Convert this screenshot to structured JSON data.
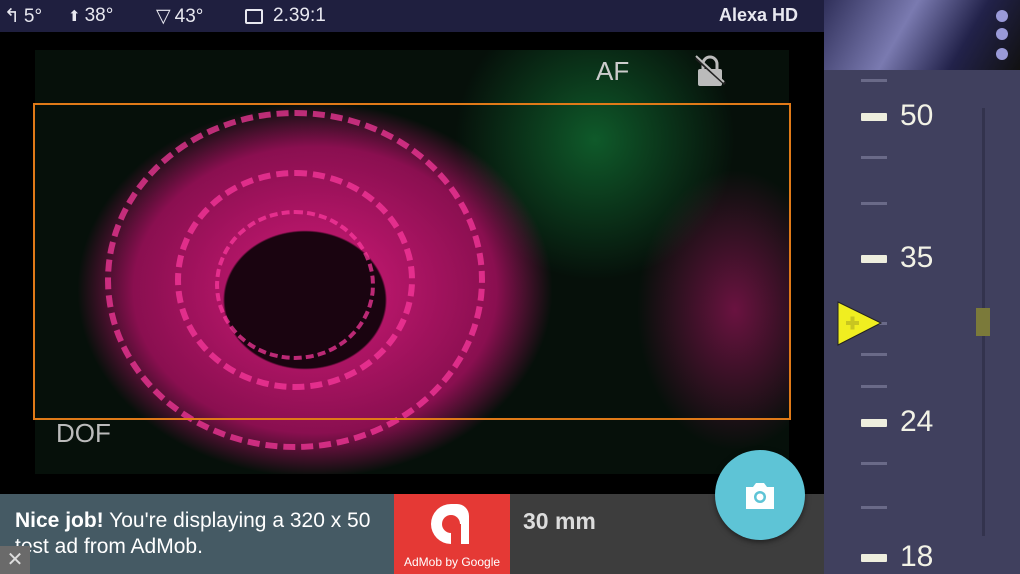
{
  "status_bar": {
    "tilt": "5°",
    "pitch": "38°",
    "fov": "43°",
    "aspect": "2.39:1",
    "camera": "Alexa HD"
  },
  "viewfinder": {
    "af_label": "AF",
    "dof_label": "DOF"
  },
  "ad": {
    "bold": "Nice job!",
    "text": " You're displaying a 320 x 50 test ad from AdMob.",
    "logo_text": "AdMob by Google",
    "close": "✕"
  },
  "focal_length": "30 mm",
  "zoom_scale": {
    "labels": [
      "50",
      "35",
      "24",
      "18"
    ],
    "current_value_mm": 30
  },
  "colors": {
    "accent": "#e07a18",
    "shutter": "#5ec4d6",
    "pointer": "#f0ee20"
  }
}
